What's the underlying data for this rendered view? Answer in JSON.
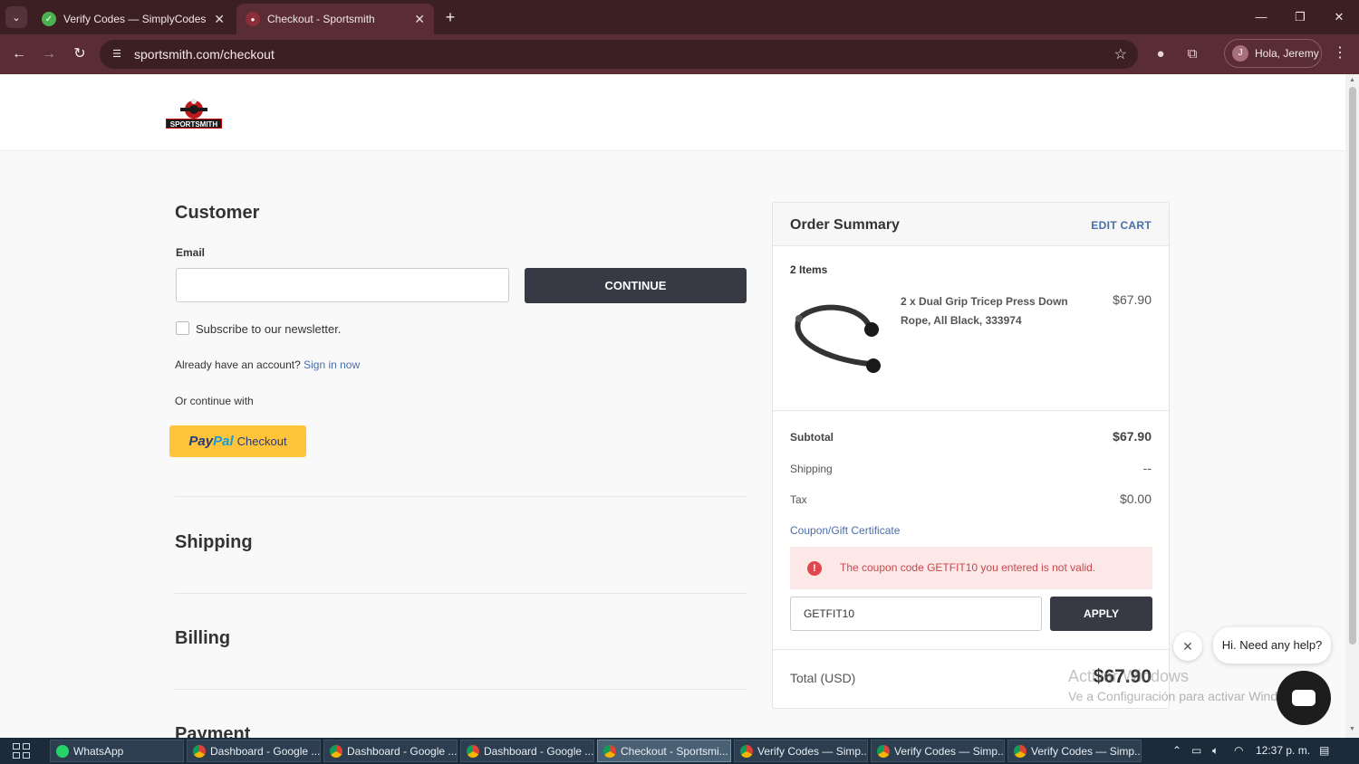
{
  "browser": {
    "tabs": [
      {
        "title": "Verify Codes — SimplyCodes",
        "active": false
      },
      {
        "title": "Checkout - Sportsmith",
        "active": true
      }
    ],
    "url": "sportsmith.com/checkout",
    "profile_label": "Hola, Jeremy",
    "profile_initial": "J"
  },
  "site": {
    "logo_text": "SPORTSMITH"
  },
  "customer": {
    "heading": "Customer",
    "email_label": "Email",
    "email_value": "",
    "continue_label": "CONTINUE",
    "newsletter_label": "Subscribe to our newsletter.",
    "account_prompt": "Already have an account?",
    "sign_in_label": "Sign in now",
    "continue_with": "Or continue with",
    "paypal_pay": "Pay",
    "paypal_pal": "Pal",
    "paypal_checkout": "Checkout"
  },
  "sections": {
    "shipping": "Shipping",
    "billing": "Billing",
    "payment": "Payment"
  },
  "summary": {
    "title": "Order Summary",
    "edit_cart": "EDIT CART",
    "items_count": "2 Items",
    "product_name": "2 x Dual Grip Tricep Press Down Rope, All Black, 333974",
    "product_price": "$67.90",
    "subtotal_label": "Subtotal",
    "subtotal_value": "$67.90",
    "shipping_label": "Shipping",
    "shipping_value": "--",
    "tax_label": "Tax",
    "tax_value": "$0.00",
    "coupon_link": "Coupon/Gift Certificate",
    "coupon_error": "The coupon code GETFIT10 you entered is not valid.",
    "coupon_value": "GETFIT10",
    "apply_label": "APPLY",
    "total_label": "Total (USD)",
    "total_value": "$67.90"
  },
  "chat": {
    "bubble_text": "Hi. Need any help?"
  },
  "watermark": {
    "line1": "Activar Windows",
    "line2": "Ve a Configuración para activar Windows."
  },
  "taskbar": {
    "items": [
      {
        "label": "WhatsApp",
        "icon": "whatsapp-icon"
      },
      {
        "label": "Dashboard - Google ...",
        "icon": "chrome-icon"
      },
      {
        "label": "Dashboard - Google ...",
        "icon": "chrome-icon"
      },
      {
        "label": "Dashboard - Google ...",
        "icon": "chrome-icon"
      },
      {
        "label": "Checkout - Sportsmi...",
        "icon": "chrome-icon"
      },
      {
        "label": "Verify Codes — Simp...",
        "icon": "chrome-icon"
      },
      {
        "label": "Verify Codes — Simp...",
        "icon": "chrome-icon"
      },
      {
        "label": "Verify Codes — Simp...",
        "icon": "chrome-icon"
      }
    ],
    "clock": "12:37 p. m."
  }
}
